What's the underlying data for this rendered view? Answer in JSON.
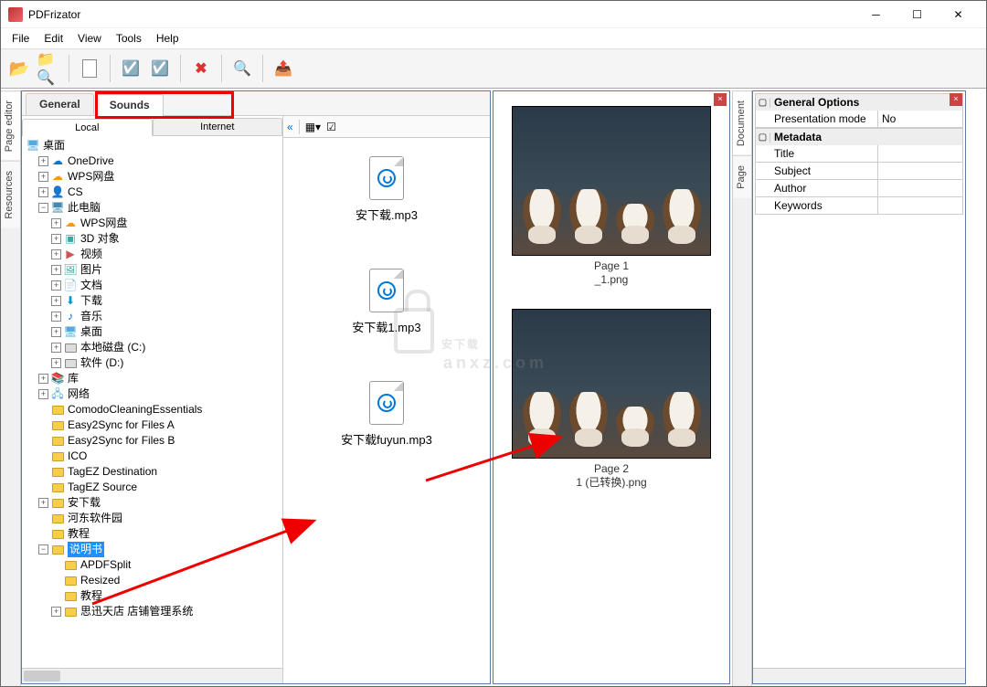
{
  "window": {
    "title": "PDFrizator"
  },
  "menu": {
    "file": "File",
    "edit": "Edit",
    "view": "View",
    "tools": "Tools",
    "help": "Help"
  },
  "sideTabsLeft": {
    "pageEditor": "Page editor",
    "resources": "Resources"
  },
  "sideTabsRight": {
    "document": "Document",
    "page": "Page"
  },
  "topTabs": {
    "general": "General",
    "sounds": "Sounds"
  },
  "subTabs": {
    "local": "Local",
    "internet": "Internet"
  },
  "fileToolbar": {
    "collapse": "«"
  },
  "tree": {
    "root": "桌面",
    "items": [
      {
        "indent": 1,
        "exp": "+",
        "icon": "cloud-blue",
        "label": "OneDrive"
      },
      {
        "indent": 1,
        "exp": "+",
        "icon": "cloud-orange",
        "label": "WPS网盘"
      },
      {
        "indent": 1,
        "exp": "+",
        "icon": "user",
        "label": "CS"
      },
      {
        "indent": 1,
        "exp": "-",
        "icon": "pc",
        "label": "此电脑"
      },
      {
        "indent": 2,
        "exp": "+",
        "icon": "cloud-orange",
        "label": "WPS网盘"
      },
      {
        "indent": 2,
        "exp": "+",
        "icon": "3d",
        "label": "3D 对象"
      },
      {
        "indent": 2,
        "exp": "+",
        "icon": "video",
        "label": "视频"
      },
      {
        "indent": 2,
        "exp": "+",
        "icon": "pic",
        "label": "图片"
      },
      {
        "indent": 2,
        "exp": "+",
        "icon": "doc",
        "label": "文档"
      },
      {
        "indent": 2,
        "exp": "+",
        "icon": "down",
        "label": "下载"
      },
      {
        "indent": 2,
        "exp": "+",
        "icon": "music",
        "label": "音乐"
      },
      {
        "indent": 2,
        "exp": "+",
        "icon": "desk",
        "label": "桌面"
      },
      {
        "indent": 2,
        "exp": "+",
        "icon": "drive",
        "label": "本地磁盘 (C:)"
      },
      {
        "indent": 2,
        "exp": "+",
        "icon": "drive",
        "label": "软件 (D:)"
      },
      {
        "indent": 1,
        "exp": "+",
        "icon": "lib",
        "label": "库"
      },
      {
        "indent": 1,
        "exp": "+",
        "icon": "net",
        "label": "网络"
      },
      {
        "indent": 1,
        "exp": "",
        "icon": "folder",
        "label": "ComodoCleaningEssentials"
      },
      {
        "indent": 1,
        "exp": "",
        "icon": "folder",
        "label": "Easy2Sync for Files A"
      },
      {
        "indent": 1,
        "exp": "",
        "icon": "folder",
        "label": "Easy2Sync for Files B"
      },
      {
        "indent": 1,
        "exp": "",
        "icon": "folder",
        "label": "ICO"
      },
      {
        "indent": 1,
        "exp": "",
        "icon": "folder",
        "label": "TagEZ Destination"
      },
      {
        "indent": 1,
        "exp": "",
        "icon": "folder",
        "label": "TagEZ Source"
      },
      {
        "indent": 1,
        "exp": "+",
        "icon": "folder",
        "label": "安下载"
      },
      {
        "indent": 1,
        "exp": "",
        "icon": "folder",
        "label": "河东软件园"
      },
      {
        "indent": 1,
        "exp": "",
        "icon": "folder",
        "label": "教程"
      },
      {
        "indent": 1,
        "exp": "-",
        "icon": "folder",
        "label": "说明书",
        "selected": true
      },
      {
        "indent": 2,
        "exp": "",
        "icon": "folder",
        "label": "APDFSplit"
      },
      {
        "indent": 2,
        "exp": "",
        "icon": "folder",
        "label": "Resized"
      },
      {
        "indent": 2,
        "exp": "",
        "icon": "folder",
        "label": "教程"
      },
      {
        "indent": 2,
        "exp": "+",
        "icon": "folder",
        "label": "思迅天店 店铺管理系统"
      }
    ]
  },
  "files": [
    {
      "name": "安下载.mp3"
    },
    {
      "name": "安下载1.mp3"
    },
    {
      "name": "安下载fuyun.mp3"
    }
  ],
  "pages": [
    {
      "title": "Page 1",
      "sub": "_1.png"
    },
    {
      "title": "Page 2",
      "sub": "1 (已转换).png"
    }
  ],
  "props": {
    "generalHead": "General Options",
    "presentationMode": "Presentation mode",
    "presentationModeVal": "No",
    "metadataHead": "Metadata",
    "title": "Title",
    "subject": "Subject",
    "author": "Author",
    "keywords": "Keywords"
  },
  "watermark": "安下载"
}
